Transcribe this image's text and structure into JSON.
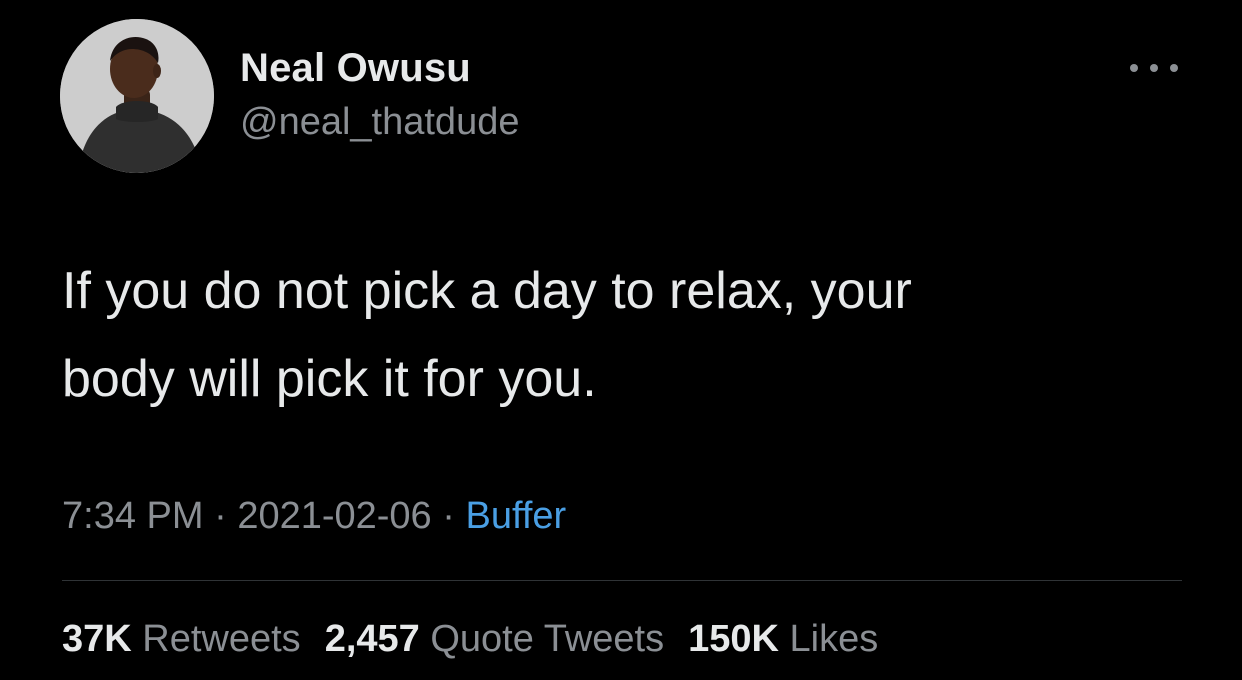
{
  "user": {
    "display_name": "Neal Owusu",
    "handle": "@neal_thatdude"
  },
  "tweet": {
    "text": "If you do not pick a day to relax, your\nbody will pick it for you."
  },
  "meta": {
    "time": "7:34 PM",
    "separator": "·",
    "date": "2021-02-06",
    "source": "Buffer"
  },
  "stats": {
    "retweets_count": "37K",
    "retweets_label": "Retweets",
    "quotes_count": "2,457",
    "quotes_label": "Quote Tweets",
    "likes_count": "150K",
    "likes_label": "Likes"
  },
  "colors": {
    "background": "#000000",
    "primary_text": "#e7e9ea",
    "secondary_text": "#8b8f94",
    "link": "#4a9fe4",
    "divider": "#2f3336"
  },
  "icons": {
    "more": "more-horizontal-icon"
  }
}
